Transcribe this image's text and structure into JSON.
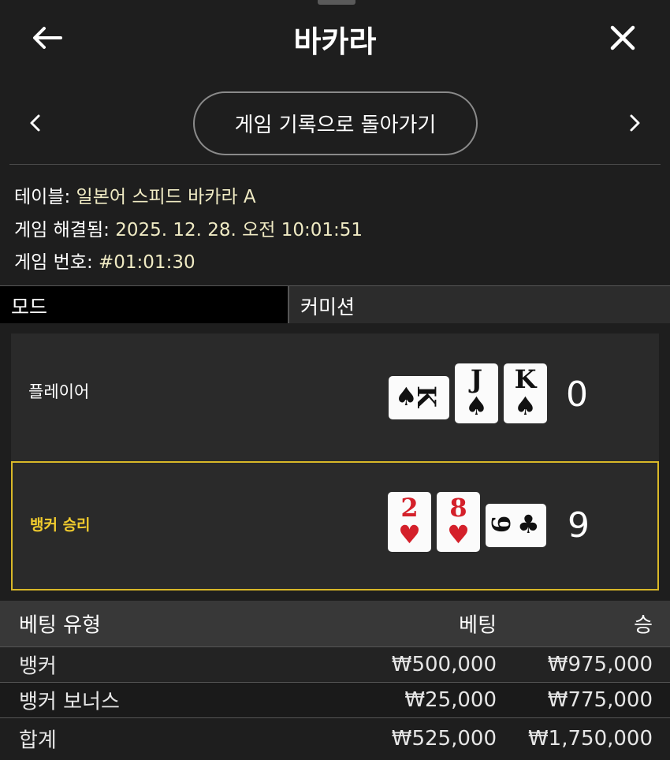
{
  "header": {
    "title": "바카라",
    "back_icon": "arrow-left-icon",
    "close_icon": "close-icon"
  },
  "nav": {
    "history_button_label": "게임 기록으로 돌아가기",
    "prev_icon": "chevron-left-icon",
    "next_icon": "chevron-right-icon"
  },
  "info": {
    "table_label": "테이블:",
    "table_value": "일본어 스피드 바카라 A",
    "resolved_label": "게임 해결됨:",
    "resolved_value": "2025. 12. 28. 오전 10:01:51",
    "game_number_label": "게임 번호:",
    "game_number_value": "#01:01:30"
  },
  "tabs": {
    "mode": "모드",
    "commission": "커미션"
  },
  "player": {
    "label": "플레이어",
    "score": "0",
    "cards": [
      {
        "rank": "K",
        "suit": "♠",
        "color": "#111111",
        "orientation": "horizontal"
      },
      {
        "rank": "J",
        "suit": "♠",
        "color": "#111111",
        "orientation": "vertical"
      },
      {
        "rank": "K",
        "suit": "♠",
        "color": "#111111",
        "orientation": "vertical"
      }
    ]
  },
  "banker": {
    "label": "뱅커 승리",
    "score": "9",
    "highlight_color": "#d9b828",
    "cards": [
      {
        "rank": "2",
        "suit": "♥",
        "color": "#d4202a",
        "orientation": "vertical"
      },
      {
        "rank": "8",
        "suit": "♥",
        "color": "#d4202a",
        "orientation": "vertical"
      },
      {
        "rank": "9",
        "suit": "♣",
        "color": "#111111",
        "orientation": "horizontal"
      }
    ]
  },
  "bets_table": {
    "headers": [
      "베팅 유형",
      "베팅",
      "승"
    ],
    "rows": [
      [
        "뱅커",
        "₩500,000",
        "₩975,000"
      ],
      [
        "뱅커 보너스",
        "₩25,000",
        "₩775,000"
      ]
    ],
    "total": [
      "합계",
      "₩525,000",
      "₩1,750,000"
    ]
  }
}
